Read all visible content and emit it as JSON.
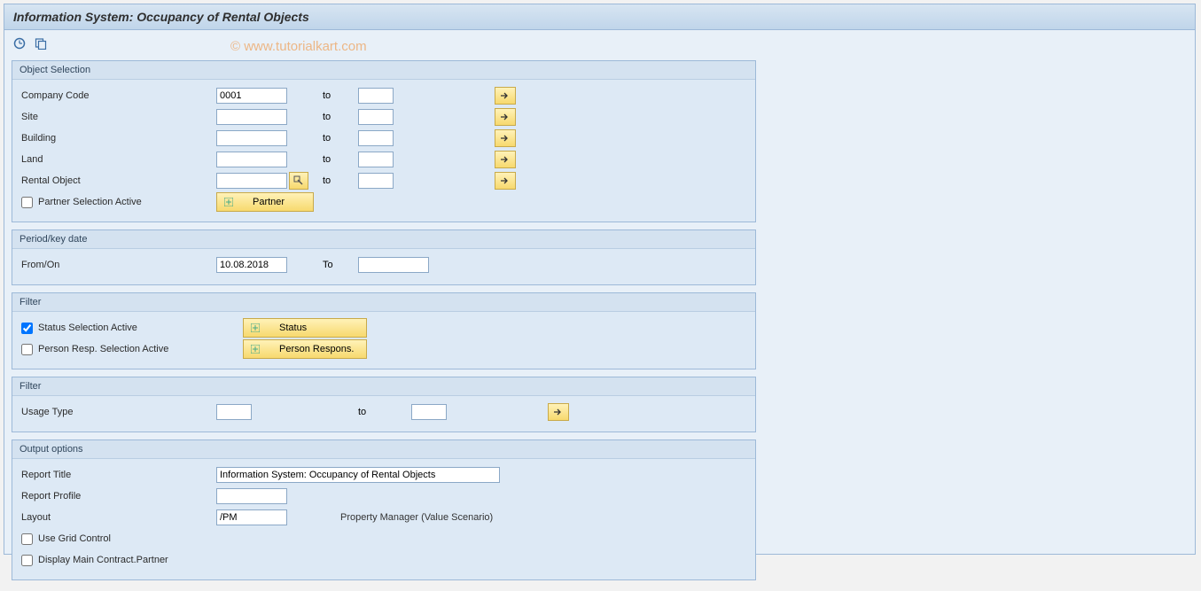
{
  "title": "Information System: Occupancy of Rental Objects",
  "watermark": "© www.tutorialkart.com",
  "groups": {
    "objectSelection": {
      "title": "Object Selection",
      "companyCode": {
        "label": "Company Code",
        "from": "0001",
        "toLabel": "to",
        "to": ""
      },
      "site": {
        "label": "Site",
        "from": "",
        "toLabel": "to",
        "to": ""
      },
      "building": {
        "label": "Building",
        "from": "",
        "toLabel": "to",
        "to": ""
      },
      "land": {
        "label": "Land",
        "from": "",
        "toLabel": "to",
        "to": ""
      },
      "rentalObject": {
        "label": "Rental Object",
        "from": "",
        "toLabel": "to",
        "to": ""
      },
      "partnerSel": {
        "label": "Partner Selection Active",
        "checked": false,
        "button": "Partner"
      }
    },
    "period": {
      "title": "Period/key date",
      "fromOn": {
        "label": "From/On",
        "from": "10.08.2018",
        "toLabel": "To",
        "to": ""
      }
    },
    "filter1": {
      "title": "Filter",
      "status": {
        "label": "Status Selection Active",
        "checked": true,
        "button": "Status"
      },
      "person": {
        "label": "Person Resp. Selection Active",
        "checked": false,
        "button": "Person Respons."
      }
    },
    "filter2": {
      "title": "Filter",
      "usageType": {
        "label": "Usage Type",
        "from": "",
        "toLabel": "to",
        "to": ""
      }
    },
    "output": {
      "title": "Output options",
      "reportTitle": {
        "label": "Report Title",
        "value": "Information System: Occupancy of Rental Objects"
      },
      "reportProfile": {
        "label": "Report Profile",
        "value": ""
      },
      "layout": {
        "label": "Layout",
        "value": "/PM",
        "desc": "Property Manager (Value Scenario)"
      },
      "useGrid": {
        "label": "Use Grid Control",
        "checked": false
      },
      "displayMain": {
        "label": "Display Main Contract.Partner",
        "checked": false
      }
    }
  }
}
